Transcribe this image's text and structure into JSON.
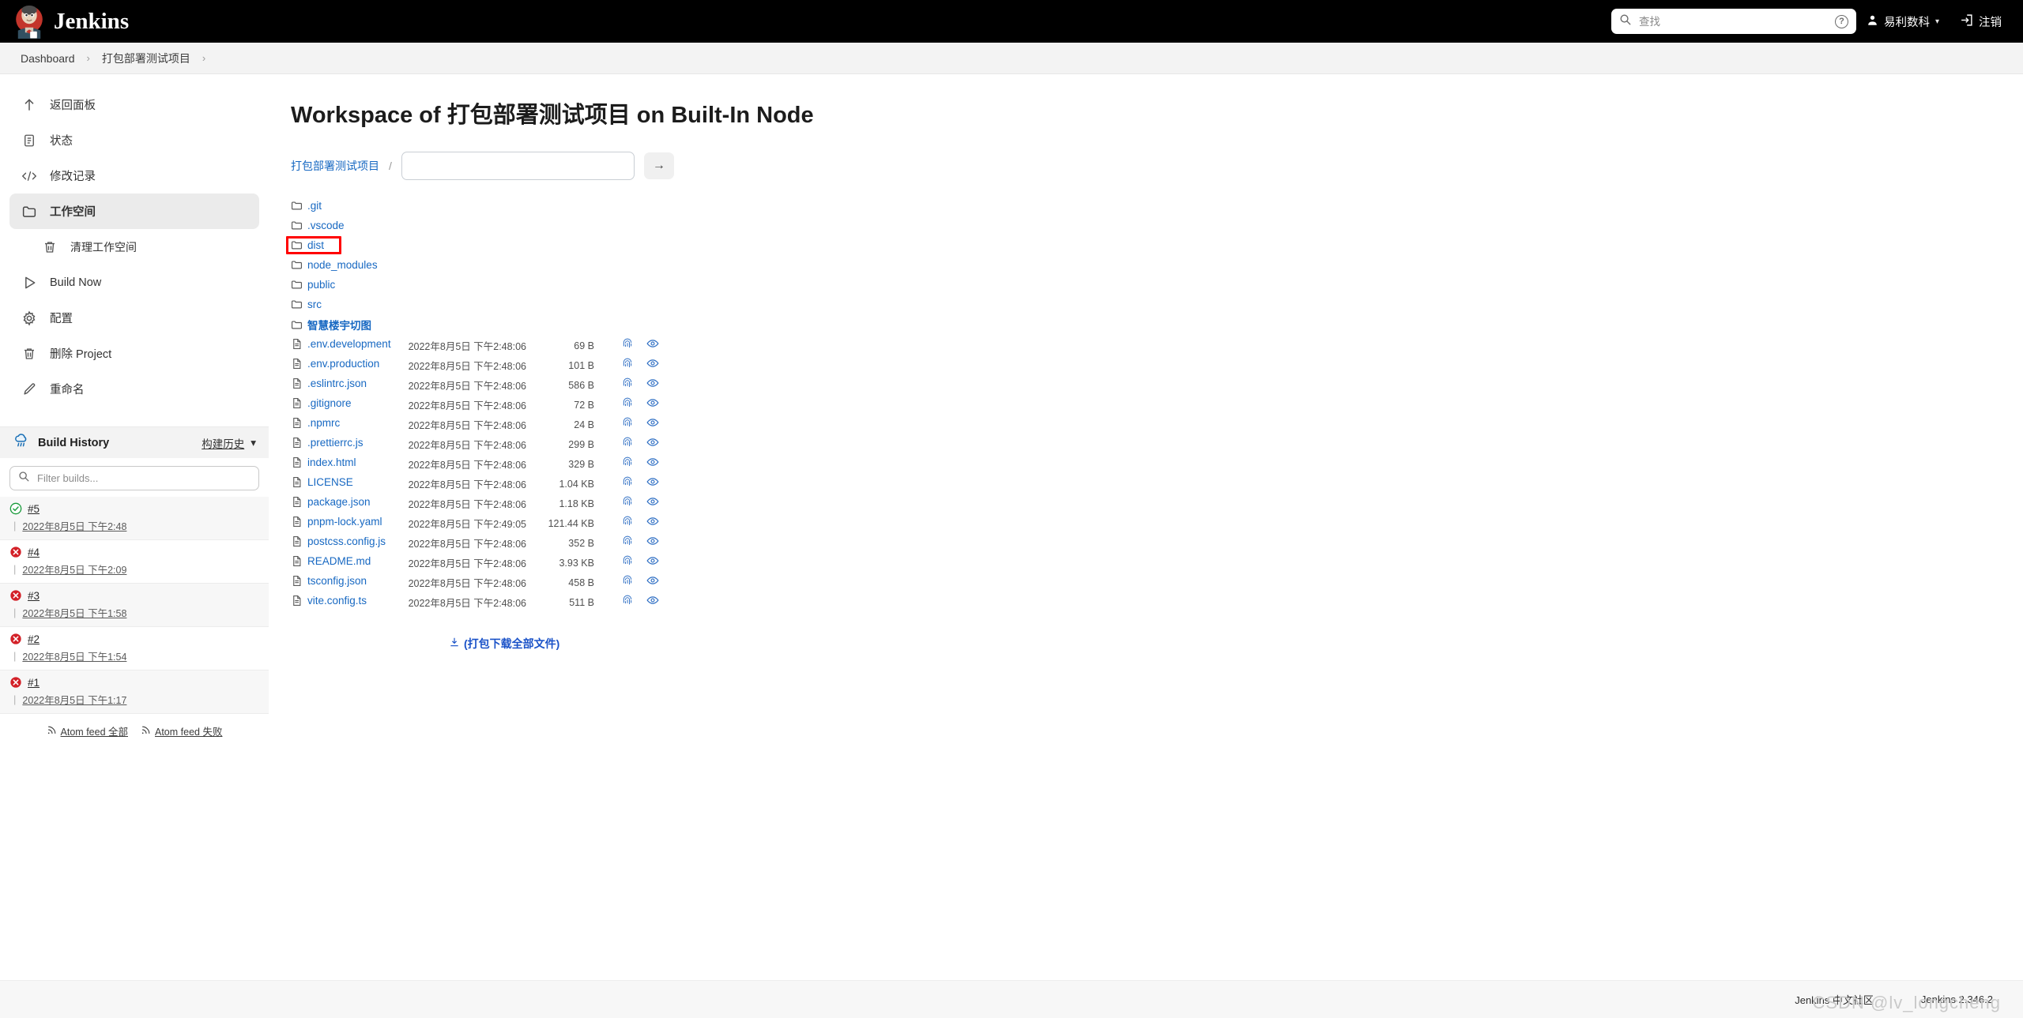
{
  "header": {
    "brand": "Jenkins",
    "logo_icon": "jenkins-butler-logo",
    "search_placeholder": "查找",
    "search_value": "",
    "search_icon": "search-icon",
    "help_icon": "help-icon",
    "help_label": "?",
    "user_icon": "person-icon",
    "user_name": "易利数科",
    "chevron_icon": "chevron-down-icon",
    "logout_icon": "logout-icon",
    "logout_label": "注销"
  },
  "breadcrumb": {
    "items": [
      {
        "label": "Dashboard"
      },
      {
        "label": "打包部署测试项目"
      }
    ],
    "separator": "›"
  },
  "sidebar": {
    "items": [
      {
        "label": "返回面板",
        "icon": "arrow-up-icon",
        "active": false,
        "sub": false
      },
      {
        "label": "状态",
        "icon": "document-icon",
        "active": false,
        "sub": false
      },
      {
        "label": "修改记录",
        "icon": "code-icon",
        "active": false,
        "sub": false
      },
      {
        "label": "工作空间",
        "icon": "folder-icon",
        "active": true,
        "sub": false
      },
      {
        "label": "清理工作空间",
        "icon": "trash-icon",
        "active": false,
        "sub": true
      },
      {
        "label": "Build Now",
        "icon": "play-icon",
        "active": false,
        "sub": false
      },
      {
        "label": "配置",
        "icon": "gear-icon",
        "active": false,
        "sub": false
      },
      {
        "label": "删除 Project",
        "icon": "trash-icon",
        "active": false,
        "sub": false
      },
      {
        "label": "重命名",
        "icon": "pencil-icon",
        "active": false,
        "sub": false
      }
    ]
  },
  "build_history": {
    "title": "Build History",
    "icon": "weather-cloud-icon",
    "trend_label": "构建历史",
    "trend_chevron": "chevron-down-icon",
    "filter_placeholder": "Filter builds...",
    "filter_value": "",
    "filter_icon": "search-icon",
    "builds": [
      {
        "number": "#5",
        "date": "2022年8月5日 下午2:48",
        "status": "success",
        "status_icon": "check-circle-icon"
      },
      {
        "number": "#4",
        "date": "2022年8月5日 下午2:09",
        "status": "failed",
        "status_icon": "x-circle-icon"
      },
      {
        "number": "#3",
        "date": "2022年8月5日 下午1:58",
        "status": "failed",
        "status_icon": "x-circle-icon"
      },
      {
        "number": "#2",
        "date": "2022年8月5日 下午1:54",
        "status": "failed",
        "status_icon": "x-circle-icon"
      },
      {
        "number": "#1",
        "date": "2022年8月5日 下午1:17",
        "status": "failed",
        "status_icon": "x-circle-icon"
      }
    ],
    "atom_all": "Atom feed 全部",
    "atom_failed": "Atom feed 失败",
    "atom_icon": "rss-icon"
  },
  "main": {
    "page_title": "Workspace of 打包部署测试项目 on Built-In Node",
    "workspace_crumb": "打包部署测试项目",
    "path_separator": "/",
    "path_input_value": "",
    "go_label": "→",
    "download_all_label": "(打包下载全部文件)",
    "download_icon": "download-icon",
    "fingerprint_icon": "fingerprint-icon",
    "view_icon": "eye-icon",
    "folder_icon": "folder-icon",
    "file_icon": "file-icon",
    "highlight_color": "#ff0000",
    "directories": [
      {
        "name": ".git",
        "cjk": false
      },
      {
        "name": ".vscode",
        "cjk": false
      },
      {
        "name": "dist",
        "cjk": false,
        "highlighted": true
      },
      {
        "name": "node_modules",
        "cjk": false
      },
      {
        "name": "public",
        "cjk": false
      },
      {
        "name": "src",
        "cjk": false
      },
      {
        "name": "智慧楼宇切图",
        "cjk": true
      }
    ],
    "files": [
      {
        "name": ".env.development",
        "date": "2022年8月5日 下午2:48:06",
        "size": "69 B"
      },
      {
        "name": ".env.production",
        "date": "2022年8月5日 下午2:48:06",
        "size": "101 B"
      },
      {
        "name": ".eslintrc.json",
        "date": "2022年8月5日 下午2:48:06",
        "size": "586 B"
      },
      {
        "name": ".gitignore",
        "date": "2022年8月5日 下午2:48:06",
        "size": "72 B"
      },
      {
        "name": ".npmrc",
        "date": "2022年8月5日 下午2:48:06",
        "size": "24 B"
      },
      {
        "name": ".prettierrc.js",
        "date": "2022年8月5日 下午2:48:06",
        "size": "299 B"
      },
      {
        "name": "index.html",
        "date": "2022年8月5日 下午2:48:06",
        "size": "329 B"
      },
      {
        "name": "LICENSE",
        "date": "2022年8月5日 下午2:48:06",
        "size": "1.04 KB"
      },
      {
        "name": "package.json",
        "date": "2022年8月5日 下午2:48:06",
        "size": "1.18 KB"
      },
      {
        "name": "pnpm-lock.yaml",
        "date": "2022年8月5日 下午2:49:05",
        "size": "121.44 KB"
      },
      {
        "name": "postcss.config.js",
        "date": "2022年8月5日 下午2:48:06",
        "size": "352 B"
      },
      {
        "name": "README.md",
        "date": "2022年8月5日 下午2:48:06",
        "size": "3.93 KB"
      },
      {
        "name": "tsconfig.json",
        "date": "2022年8月5日 下午2:48:06",
        "size": "458 B"
      },
      {
        "name": "vite.config.ts",
        "date": "2022年8月5日 下午2:48:06",
        "size": "511 B"
      }
    ]
  },
  "footer": {
    "community": "Jenkins 中文社区",
    "version": "Jenkins 2.346.2",
    "watermark": "CSDN @lv_longcheng"
  }
}
